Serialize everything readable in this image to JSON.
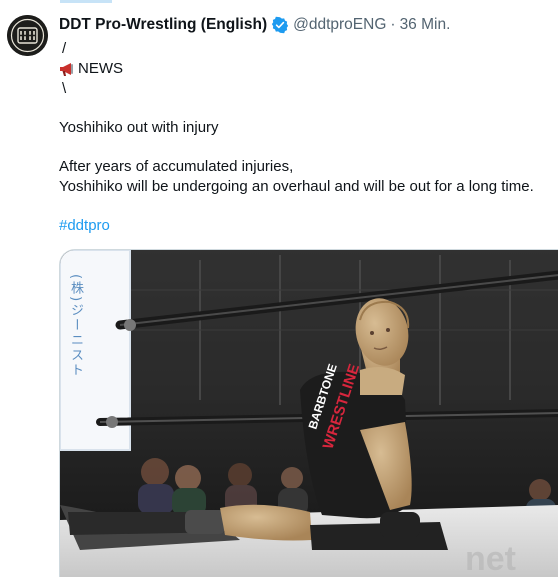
{
  "tweet": {
    "author_name": "DDT Pro-Wrestling (English)",
    "handle": "@ddtproENG",
    "separator": "·",
    "time": "36 Min.",
    "avatar_logo_text": "DDT",
    "lines": {
      "slash": "/",
      "news": "NEWS",
      "backslash": "\\",
      "headline": "Yoshihiko out with injury",
      "body1": "After years of accumulated injuries,",
      "body2": "Yoshihiko will be undergoing an overhaul and will be out for a long time.",
      "hashtag": "#ddtpro"
    }
  },
  "media": {
    "banner_text": "(株)ジーニスト",
    "shirt_line1": "BARBTONE",
    "shirt_line2": "WRESTLINE",
    "colors": {
      "accent": "#1d9bf0",
      "verified": "#1d9bf0",
      "shirt": "#1c1c1c",
      "shirt_text": "#d7263d"
    }
  }
}
